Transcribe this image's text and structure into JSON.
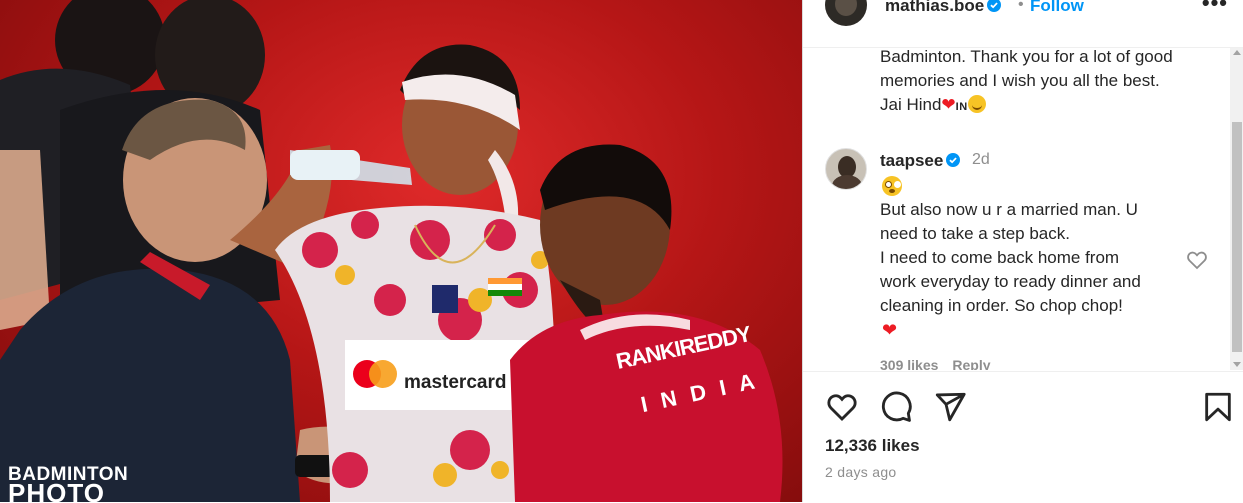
{
  "post": {
    "watermark_line1": "BADMINTON",
    "watermark_line2": "PHOTO",
    "logo_text": "mastercard",
    "shirt_name": "RANKIREDDY",
    "shirt_country": "I N D I A"
  },
  "header": {
    "username": "mathias.boe",
    "separator": "•",
    "follow_label": "Follow",
    "more_label": "•••"
  },
  "caption": {
    "lines": [
      "Badminton. Thank you for a lot of good",
      "memories and I wish you all the best."
    ],
    "last_line_text": "Jai Hind",
    "flag_text": "IN"
  },
  "comment": {
    "username": "taapsee",
    "time": "2d",
    "lines": [
      "But also now u r a married man. U",
      "need to take a step back.",
      "I need to come back home from",
      "work everyday to ready dinner and",
      "cleaning in order. So chop chop!"
    ],
    "heart": "❤",
    "likes": "309 likes",
    "reply_label": "Reply"
  },
  "footer": {
    "likes": "12,336 likes",
    "time_ago": "2 days ago"
  },
  "colors": {
    "follow": "#0095f6",
    "verified": "#0095f6",
    "heart": "#ed1c24",
    "jersey_red": "#c8102e"
  },
  "icons": [
    "verified-badge-icon",
    "more-options-icon",
    "heart-icon",
    "comment-icon",
    "share-icon",
    "bookmark-icon",
    "comment-like-icon"
  ]
}
